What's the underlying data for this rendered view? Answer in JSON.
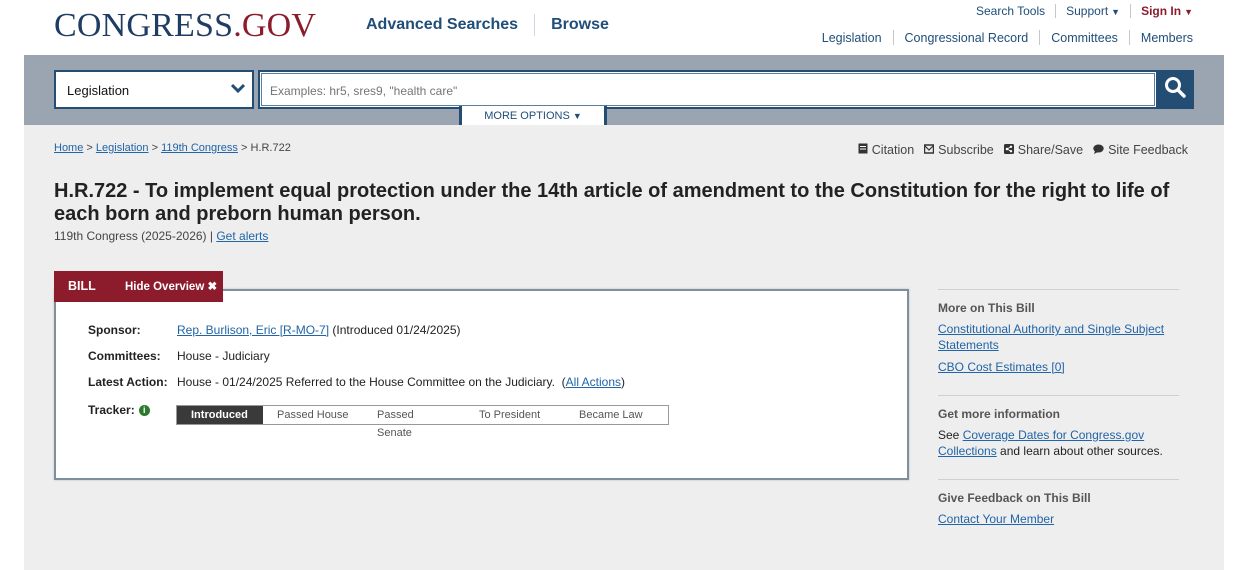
{
  "header": {
    "logo": {
      "congress": "CONGRESS",
      "dot": ".",
      "gov": "GOV"
    },
    "main_nav": [
      "Advanced Searches",
      "Browse"
    ],
    "util_nav": {
      "search_tools": "Search Tools",
      "support": "Support",
      "sign_in": "Sign In"
    },
    "sub_nav": [
      "Legislation",
      "Congressional Record",
      "Committees",
      "Members"
    ]
  },
  "search": {
    "collection": "Legislation",
    "placeholder": "Examples: hr5, sres9, \"health care\"",
    "more_options": "MORE OPTIONS"
  },
  "breadcrumb": {
    "home": "Home",
    "sep": ">",
    "legislation": "Legislation",
    "congress": "119th Congress",
    "current": "H.R.722"
  },
  "page_actions": [
    "Citation",
    "Subscribe",
    "Share/Save",
    "Site Feedback"
  ],
  "bill": {
    "title": "H.R.722 - To implement equal protection under the 14th article of amendment to the Constitution for the right to life of each born and preborn human person.",
    "congress_text": "119th Congress (2025-2026) |",
    "get_alerts": "Get alerts",
    "tab_label": "BILL",
    "hide_overview": "Hide Overview",
    "overview": {
      "sponsor_label": "Sponsor:",
      "sponsor_link": "Rep. Burlison, Eric [R-MO-7]",
      "sponsor_intro": "(Introduced 01/24/2025)",
      "committees_label": "Committees:",
      "committees_value": "House - Judiciary",
      "latest_label": "Latest Action:",
      "latest_value": "House - 01/24/2025 Referred to the House Committee on the Judiciary.",
      "all_actions": "All Actions",
      "tracker_label": "Tracker:",
      "tracker_steps": [
        "Introduced",
        "Passed House",
        "Passed Senate",
        "To President",
        "Became Law"
      ],
      "tracker_current": "Introduced"
    }
  },
  "sidebar": {
    "more_title": "More on This Bill",
    "more_links": [
      "Constitutional Authority and Single Subject Statements",
      "CBO Cost Estimates [0]"
    ],
    "info_title": "Get more information",
    "info_prefix": "See",
    "info_link": "Coverage Dates for Congress.gov Collections",
    "info_suffix": "and learn about other sources.",
    "feedback_title": "Give Feedback on This Bill",
    "feedback_link": "Contact Your Member"
  },
  "colors": {
    "brand_navy": "#1f3d62",
    "brand_red": "#8c1c2c",
    "link": "#2164a8",
    "search_band": "#9aa5b1"
  }
}
